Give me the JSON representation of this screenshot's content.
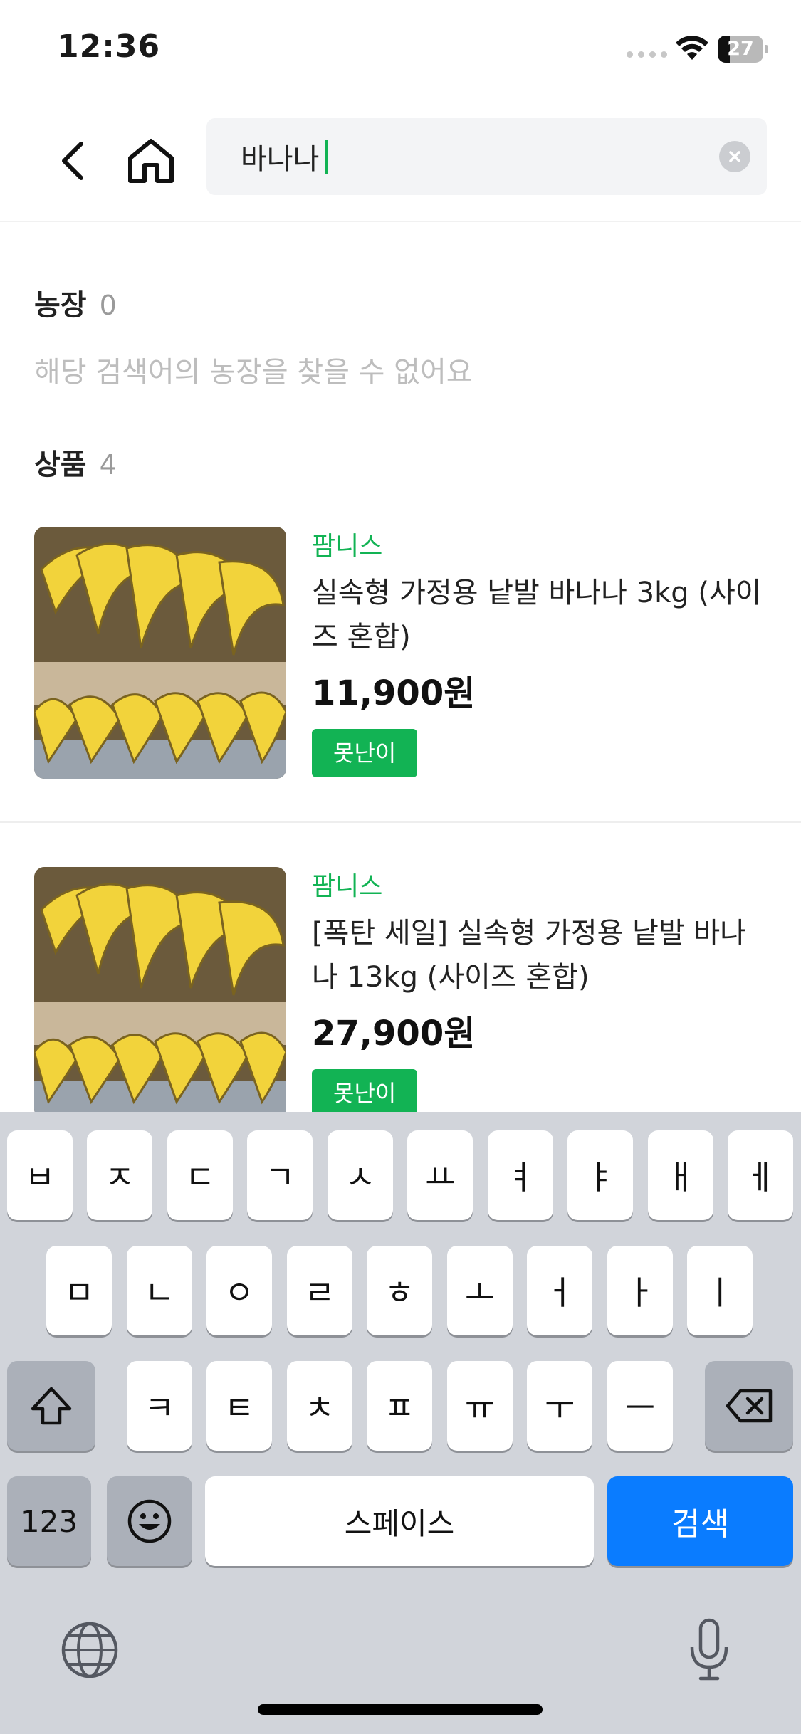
{
  "status_bar": {
    "time": "12:36",
    "battery": "27",
    "battery_level": 0.27
  },
  "header": {
    "search_value": "바나나",
    "clear_label": "검색어 지우기"
  },
  "farms": {
    "title": "농장",
    "count": "0",
    "empty_message": "해당 검색어의 농장을 찾을 수 없어요"
  },
  "products": {
    "title": "상품",
    "count": "4",
    "items": [
      {
        "farm": "팜니스",
        "name": "실속형 가정용 낱발 바나나 3kg (사이즈 혼합)",
        "price": "11,900원",
        "tag": "못난이"
      },
      {
        "farm": "팜니스",
        "name": "[폭탄 세일] 실속형 가정용 낱발 바나나 13kg (사이즈 혼합)",
        "price": "27,900원",
        "tag": "못난이"
      }
    ]
  },
  "keyboard": {
    "row1": [
      "ㅂ",
      "ㅈ",
      "ㄷ",
      "ㄱ",
      "ㅅ",
      "ㅛ",
      "ㅕ",
      "ㅑ",
      "ㅐ",
      "ㅔ"
    ],
    "row2": [
      "ㅁ",
      "ㄴ",
      "ㅇ",
      "ㄹ",
      "ㅎ",
      "ㅗ",
      "ㅓ",
      "ㅏ",
      "ㅣ"
    ],
    "row3": [
      "ㅋ",
      "ㅌ",
      "ㅊ",
      "ㅍ",
      "ㅠ",
      "ㅜ",
      "ㅡ"
    ],
    "numbers_label": "123",
    "space_label": "스페이스",
    "search_label": "검색"
  },
  "colors": {
    "accent": "#12b354",
    "keyboard_blue": "#0a7cff",
    "keyboard_bg": "#d1d4da"
  },
  "icons": [
    "back-arrow-icon",
    "home-icon",
    "clear-icon",
    "shift-icon",
    "delete-icon",
    "emoji-icon",
    "globe-icon",
    "microphone-icon"
  ]
}
